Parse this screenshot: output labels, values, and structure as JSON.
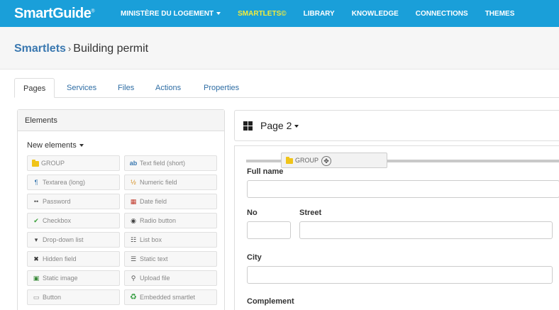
{
  "app": {
    "brand": "SmartGuide",
    "brand_mark": "®"
  },
  "nav": [
    {
      "label": "MINISTÈRE DU LOGEMENT",
      "dropdown": true,
      "active": false
    },
    {
      "label": "SMARTLETS©",
      "dropdown": false,
      "active": true
    },
    {
      "label": "LIBRARY",
      "dropdown": false,
      "active": false
    },
    {
      "label": "KNOWLEDGE",
      "dropdown": false,
      "active": false
    },
    {
      "label": "CONNECTIONS",
      "dropdown": false,
      "active": false
    },
    {
      "label": "THEMES",
      "dropdown": false,
      "active": false
    }
  ],
  "breadcrumb": {
    "root": "Smartlets",
    "separator": "›",
    "current": "Building permit"
  },
  "tabs": [
    {
      "label": "Pages",
      "active": true
    },
    {
      "label": "Services",
      "active": false
    },
    {
      "label": "Files",
      "active": false
    },
    {
      "label": "Actions",
      "active": false
    },
    {
      "label": "Properties",
      "active": false
    }
  ],
  "elements_panel": {
    "heading": "Elements",
    "new_elements": "New elements",
    "items": [
      {
        "label": "GROUP",
        "icon": "folder-icon"
      },
      {
        "label": "Text field (short)",
        "icon": "text-field-icon",
        "glyph": "ab"
      },
      {
        "label": "Textarea (long)",
        "icon": "textarea-icon",
        "glyph": "¶"
      },
      {
        "label": "Numeric field",
        "icon": "numeric-field-icon",
        "glyph": "½"
      },
      {
        "label": "Password",
        "icon": "password-icon",
        "glyph": "••"
      },
      {
        "label": "Date field",
        "icon": "calendar-icon",
        "glyph": "▦"
      },
      {
        "label": "Checkbox",
        "icon": "checkmark-icon",
        "glyph": "✔"
      },
      {
        "label": "Radio button",
        "icon": "radio-icon",
        "glyph": "◉"
      },
      {
        "label": "Drop-down list",
        "icon": "dropdown-icon",
        "glyph": "▾"
      },
      {
        "label": "List box",
        "icon": "listbox-icon",
        "glyph": "☷"
      },
      {
        "label": "Hidden field",
        "icon": "hidden-field-icon",
        "glyph": "✖"
      },
      {
        "label": "Static text",
        "icon": "static-text-icon",
        "glyph": "☰"
      },
      {
        "label": "Static image",
        "icon": "image-icon",
        "glyph": "▣"
      },
      {
        "label": "Upload file",
        "icon": "paperclip-icon",
        "glyph": "⚲"
      },
      {
        "label": "Button",
        "icon": "button-icon",
        "glyph": "▭"
      },
      {
        "label": "Embedded smartlet",
        "icon": "recycle-icon",
        "glyph": "♻"
      }
    ]
  },
  "page": {
    "title": "Page 2"
  },
  "drag_chip": {
    "label": "GROUP"
  },
  "form": {
    "fullname_label": "Full name",
    "no_label": "No",
    "street_label": "Street",
    "city_label": "City",
    "complement_label": "Complement"
  },
  "colors": {
    "nav_bg": "#1a9fd9",
    "nav_active": "#f4ec3a",
    "link": "#3a78b0"
  }
}
